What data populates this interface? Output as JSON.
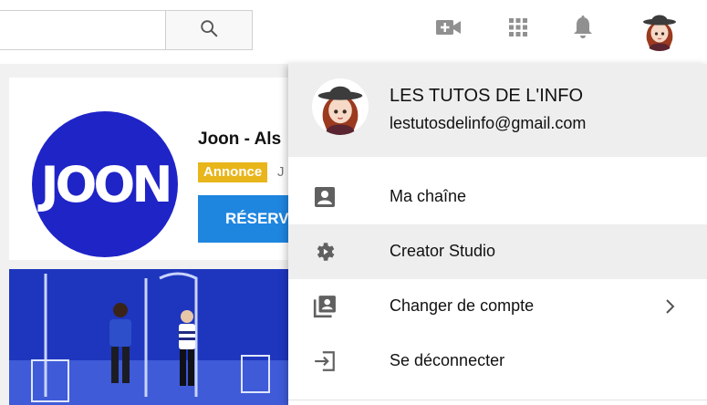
{
  "header": {
    "search": {
      "value": "",
      "placeholder": ""
    },
    "icons": [
      "search-icon",
      "upload-video-icon",
      "apps-grid-icon",
      "notifications-bell-icon"
    ]
  },
  "background": {
    "ad": {
      "title": "Joon - Als",
      "badge": "Annonce",
      "source": "J",
      "cta": "RÉSERV",
      "logo_text": "JOON"
    }
  },
  "account_menu": {
    "name": "LES TUTOS DE L'INFO",
    "email": "lestutosdelinfo@gmail.com",
    "items": [
      {
        "label": "Ma chaîne",
        "icon": "account-box-icon"
      },
      {
        "label": "Creator Studio",
        "icon": "gear-icon"
      },
      {
        "label": "Changer de compte",
        "icon": "switch-account-icon",
        "chevron": "chevron-right-icon"
      },
      {
        "label": "Se déconnecter",
        "icon": "sign-out-icon"
      }
    ]
  },
  "colors": {
    "ad_badge": "#e8b51b",
    "cta_blue": "#1f86e0",
    "logo_blue": "#1f24c7",
    "menu_hover": "#eeeeee",
    "icon_grey": "#606060"
  }
}
